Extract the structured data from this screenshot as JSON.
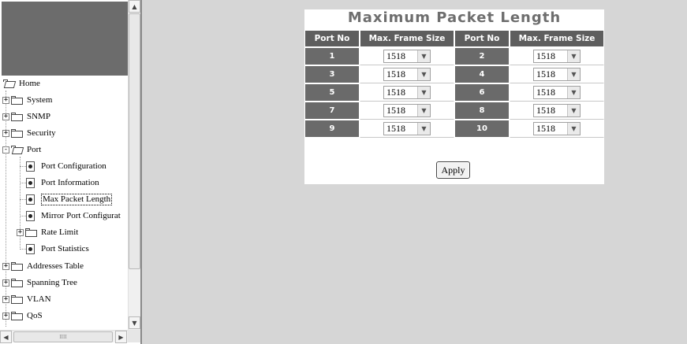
{
  "nav": {
    "items": [
      {
        "label": "Home",
        "type": "folder-open",
        "level": 0,
        "expander": ""
      },
      {
        "label": "System",
        "type": "folder",
        "level": 0,
        "expander": "+"
      },
      {
        "label": "SNMP",
        "type": "folder",
        "level": 0,
        "expander": "+"
      },
      {
        "label": "Security",
        "type": "folder",
        "level": 0,
        "expander": "+"
      },
      {
        "label": "Port",
        "type": "folder-open",
        "level": 0,
        "expander": "-"
      },
      {
        "label": "Port Configuration",
        "type": "page",
        "level": 1
      },
      {
        "label": "Port Information",
        "type": "page",
        "level": 1
      },
      {
        "label": "Max Packet Length",
        "type": "page",
        "level": 1,
        "selected": true
      },
      {
        "label": "Mirror Port Configurat",
        "type": "page",
        "level": 1
      },
      {
        "label": "Rate Limit",
        "type": "folder",
        "level": 1,
        "expander": "+"
      },
      {
        "label": "Port Statistics",
        "type": "page",
        "level": 1
      },
      {
        "label": "Addresses Table",
        "type": "folder",
        "level": 0,
        "expander": "+"
      },
      {
        "label": "Spanning Tree",
        "type": "folder",
        "level": 0,
        "expander": "+"
      },
      {
        "label": "VLAN",
        "type": "folder",
        "level": 0,
        "expander": "+"
      },
      {
        "label": "QoS",
        "type": "folder",
        "level": 0,
        "expander": "+"
      }
    ],
    "icons": {
      "scroll_up": "▲",
      "scroll_down": "▼",
      "scroll_left": "◀",
      "scroll_right": "▶",
      "thumb_grip": "IIII"
    }
  },
  "main": {
    "title": "Maximum Packet Length",
    "headers": [
      "Port No",
      "Max. Frame Size",
      "Port No",
      "Max. Frame Size"
    ],
    "rows": [
      {
        "left_port": "1",
        "left_size": "1518",
        "right_port": "2",
        "right_size": "1518"
      },
      {
        "left_port": "3",
        "left_size": "1518",
        "right_port": "4",
        "right_size": "1518"
      },
      {
        "left_port": "5",
        "left_size": "1518",
        "right_port": "6",
        "right_size": "1518"
      },
      {
        "left_port": "7",
        "left_size": "1518",
        "right_port": "8",
        "right_size": "1518"
      },
      {
        "left_port": "9",
        "left_size": "1518",
        "right_port": "10",
        "right_size": "1518"
      }
    ],
    "dropdown_arrow": "▼",
    "apply_label": "Apply"
  },
  "colors": {
    "background": "#d6d6d6",
    "header": "#5e5e5e",
    "port_cell": "#6a6a6a",
    "title": "#6e6e6e",
    "logo_block": "#6c6c6c"
  }
}
